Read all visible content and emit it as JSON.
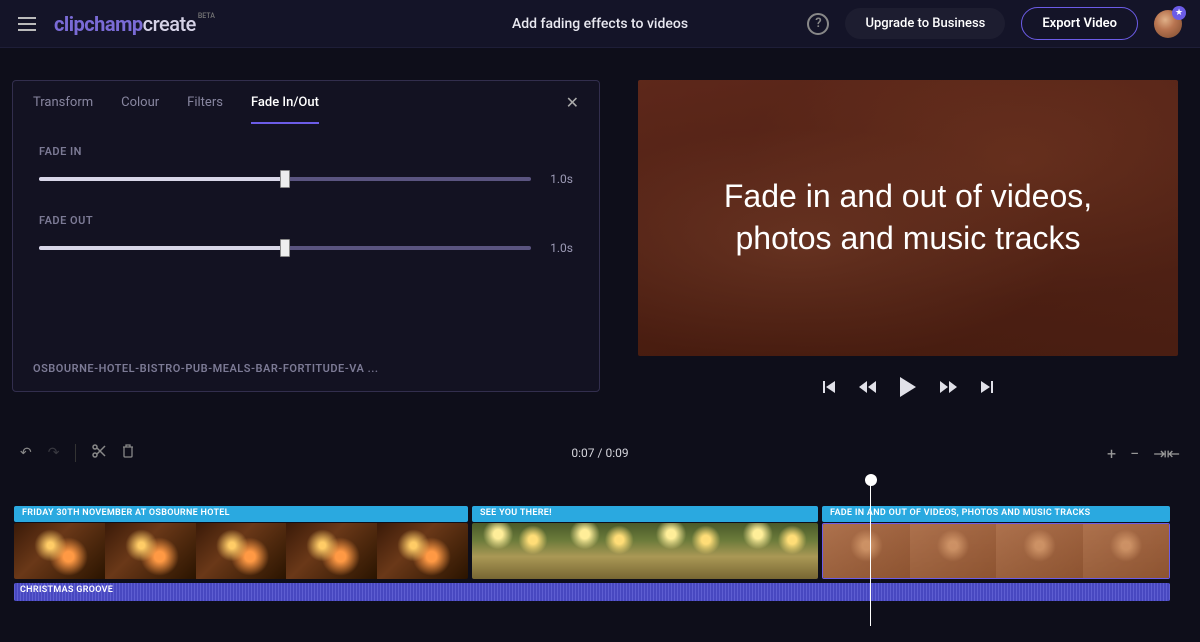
{
  "header": {
    "logo_clip": "clipchamp",
    "logo_create": "create",
    "logo_beta": "BETA",
    "title": "Add fading effects to videos",
    "upgrade": "Upgrade to Business",
    "export": "Export Video"
  },
  "panel": {
    "tabs": {
      "transform": "Transform",
      "colour": "Colour",
      "filters": "Filters",
      "fade": "Fade In/Out"
    },
    "fade_in_label": "FADE IN",
    "fade_in_value": "1.0s",
    "fade_out_label": "FADE OUT",
    "fade_out_value": "1.0s",
    "clip_name": "OSBOURNE-HOTEL-BISTRO-PUB-MEALS-BAR-FORTITUDE-VA ..."
  },
  "preview": {
    "overlay_text": "Fade in and out of videos, photos and music tracks"
  },
  "timeline": {
    "time_display": "0:07 / 0:09",
    "labels": {
      "t1": "FRIDAY 30TH NOVEMBER AT OSBOURNE HOTEL",
      "t2": "SEE YOU THERE!",
      "t3": "FADE IN AND OUT OF VIDEOS, PHOTOS AND MUSIC TRACKS"
    },
    "audio_name": "CHRISTMAS GROOVE"
  },
  "colors": {
    "accent": "#6c5ce7",
    "label_blue": "#2aa9e0",
    "audio_purple": "#4848c0"
  }
}
